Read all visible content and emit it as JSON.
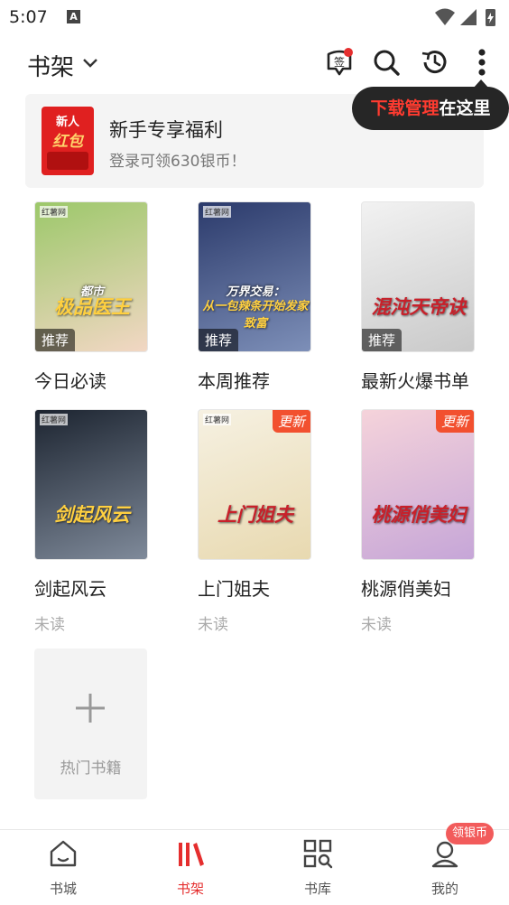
{
  "status_bar": {
    "time": "5:07",
    "notification_letter": "A"
  },
  "header": {
    "title": "书架",
    "sign_label": "签",
    "tooltip_highlight": "下载管理",
    "tooltip_rest": "在这里"
  },
  "promo": {
    "image_text_1": "新人",
    "image_text_2": "红包",
    "title": "新手专享福利",
    "subtitle": "登录可领630银币！"
  },
  "books": [
    {
      "title": "今日必读",
      "status": "",
      "tag": "推荐",
      "update": "",
      "cover_text": "极品医王",
      "cover_top": "都市",
      "brand": "红薯网",
      "colors": [
        "#9cc86a",
        "#f2d7c4"
      ]
    },
    {
      "title": "本周推荐",
      "status": "",
      "tag": "推荐",
      "update": "",
      "cover_text": "从一包辣条开始发家致富",
      "cover_top": "万界交易：",
      "brand": "红薯网",
      "colors": [
        "#2b3a6b",
        "#7d8fb8"
      ]
    },
    {
      "title": "最新火爆书单",
      "status": "",
      "tag": "推荐",
      "update": "",
      "cover_text": "混沌天帝诀",
      "cover_top": "",
      "brand": "",
      "colors": [
        "#f2f2f2",
        "#c9c9c9"
      ]
    },
    {
      "title": "剑起风云",
      "status": "未读",
      "tag": "",
      "update": "",
      "cover_text": "剑起风云",
      "cover_top": "",
      "brand": "红薯网",
      "colors": [
        "#1c2430",
        "#7f8a9a"
      ]
    },
    {
      "title": "上门姐夫",
      "status": "未读",
      "tag": "",
      "update": "更新",
      "cover_text": "上门姐夫",
      "cover_top": "",
      "brand": "红薯网",
      "colors": [
        "#f6f1e2",
        "#e8d9b0"
      ]
    },
    {
      "title": "桃源俏美妇",
      "status": "未读",
      "tag": "",
      "update": "更新",
      "cover_text": "桃源俏美妇",
      "cover_top": "",
      "brand": "",
      "colors": [
        "#f5d3da",
        "#c6a6d8"
      ]
    }
  ],
  "add_book": {
    "label": "热门书籍"
  },
  "bottom_nav": {
    "items": [
      {
        "label": "书城",
        "icon": "home-icon",
        "active": false
      },
      {
        "label": "书架",
        "icon": "bookshelf-icon",
        "active": true
      },
      {
        "label": "书库",
        "icon": "library-icon",
        "active": false
      },
      {
        "label": "我的",
        "icon": "profile-icon",
        "active": false
      }
    ],
    "badge": "领银币"
  },
  "colors": {
    "accent": "#e52e2e",
    "update_badge": "#f2502f",
    "tooltip_bg": "#262626"
  }
}
